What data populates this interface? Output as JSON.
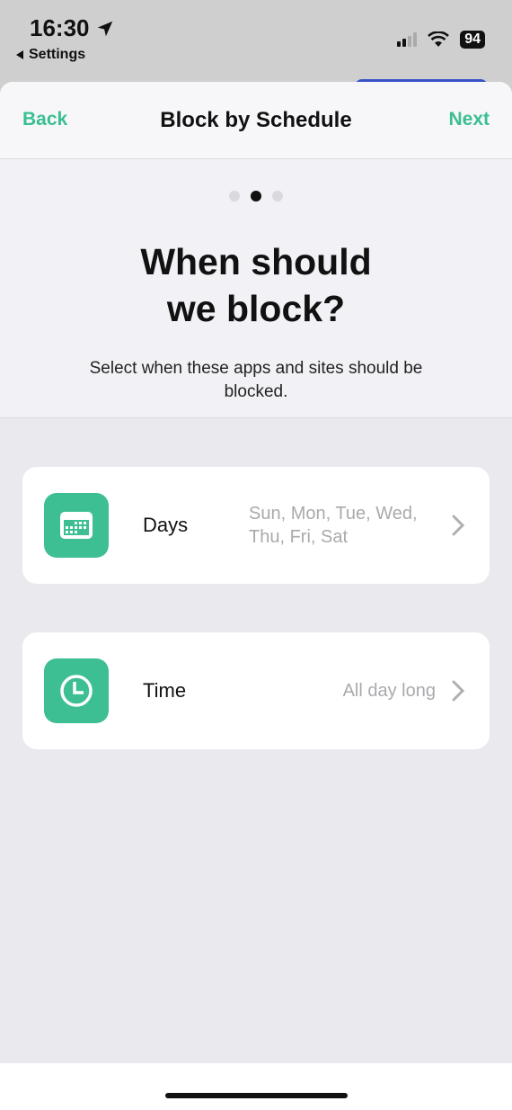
{
  "status_bar": {
    "time": "16:30",
    "back_app": "Settings",
    "battery": "94",
    "icons": [
      "location-arrow-icon",
      "cellular-signal-icon",
      "wifi-icon",
      "battery-icon"
    ]
  },
  "nav": {
    "back_label": "Back",
    "title": "Block by Schedule",
    "next_label": "Next",
    "accent_color": "#3bbf91"
  },
  "pager": {
    "total": 3,
    "current": 2
  },
  "header": {
    "headline_line1": "When should",
    "headline_line2": "we block?",
    "subtitle": "Select when these apps and sites should be blocked."
  },
  "options": [
    {
      "label": "Days",
      "value": "Sun, Mon, Tue, Wed, Thu, Fri, Sat",
      "icon": "calendar-icon"
    },
    {
      "label": "Time",
      "value": "All day long",
      "icon": "clock-icon"
    }
  ]
}
